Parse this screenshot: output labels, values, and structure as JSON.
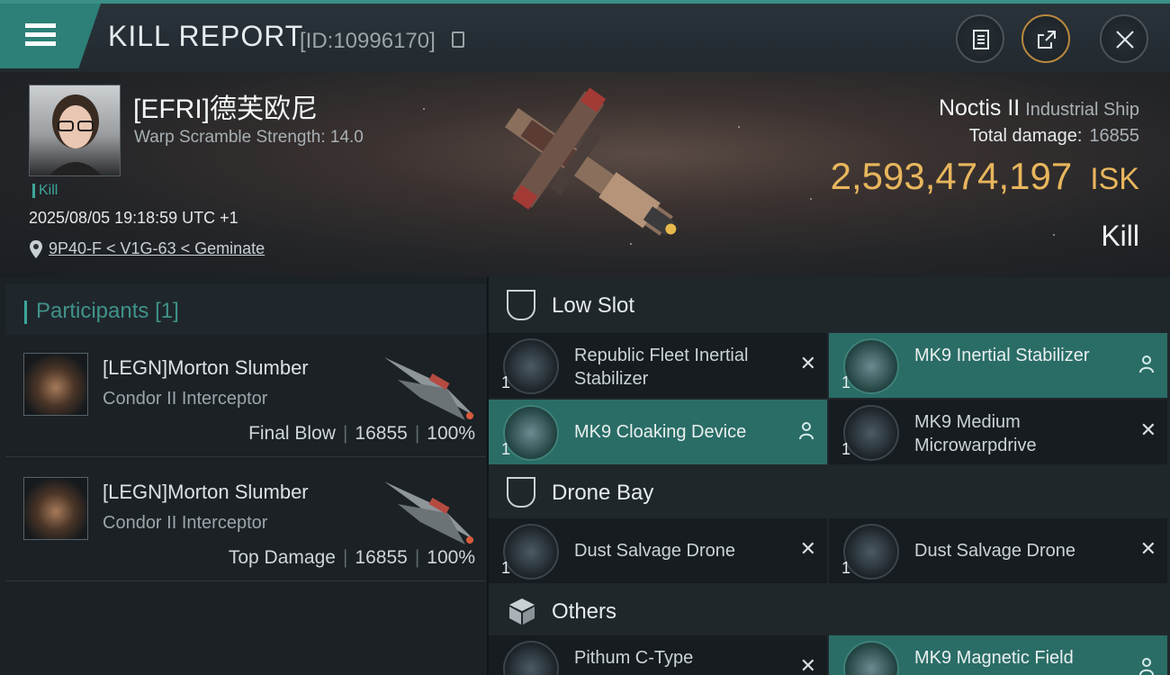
{
  "header": {
    "title": "KILL REPORT",
    "report_id": "[ID:10996170]"
  },
  "victim": {
    "name": "[EFRI]德芙欧尼",
    "warp_scramble": "Warp Scramble Strength: 14.0",
    "tag": "Kill",
    "timestamp": "2025/08/05 19:18:59 UTC +1",
    "location": "9P40-F < V1G-63 < Geminate",
    "ship": "Noctis II",
    "ship_class": "Industrial Ship",
    "total_damage_label": "Total damage:",
    "total_damage": "16855",
    "isk_value": "2,593,474,197",
    "isk_unit": "ISK",
    "result": "Kill"
  },
  "participants": {
    "label": "Participants",
    "count": "[1]",
    "items": [
      {
        "name": "[LEGN]Morton Slumber",
        "ship": "Condor II Interceptor",
        "role": "Final Blow",
        "damage": "16855",
        "percent": "100%"
      },
      {
        "name": "[LEGN]Morton Slumber",
        "ship": "Condor II Interceptor",
        "role": "Top Damage",
        "damage": "16855",
        "percent": "100%"
      }
    ]
  },
  "sections": {
    "low_slot": {
      "label": "Low Slot",
      "items": [
        {
          "name": "Republic Fleet Inertial Stabilizer",
          "qty": "1",
          "status": "destroyed",
          "icon": "stabilizer-icon"
        },
        {
          "name": "MK9 Inertial Stabilizer",
          "qty": "1",
          "status": "dropped",
          "icon": "stabilizer-icon"
        },
        {
          "name": "MK9 Cloaking Device",
          "qty": "1",
          "status": "dropped",
          "icon": "cloak-icon"
        },
        {
          "name": "MK9 Medium Microwarpdrive",
          "qty": "1",
          "status": "destroyed",
          "icon": "mwd-icon"
        }
      ]
    },
    "drone_bay": {
      "label": "Drone Bay",
      "items": [
        {
          "name": "Dust Salvage Drone",
          "qty": "1",
          "status": "destroyed",
          "icon": "drone-icon"
        },
        {
          "name": "Dust Salvage Drone",
          "qty": "1",
          "status": "destroyed",
          "icon": "drone-icon"
        }
      ]
    },
    "others": {
      "label": "Others",
      "items": [
        {
          "name": "Pithum C-Type",
          "qty": "",
          "status": "destroyed",
          "icon": "shield-module-icon"
        },
        {
          "name": "MK9 Magnetic Field",
          "qty": "",
          "status": "dropped",
          "icon": "magnetic-field-icon"
        }
      ]
    }
  },
  "colors": {
    "accent": "#3aa69b",
    "dropped": "#2a6d66",
    "isk": "#e8b65d"
  }
}
